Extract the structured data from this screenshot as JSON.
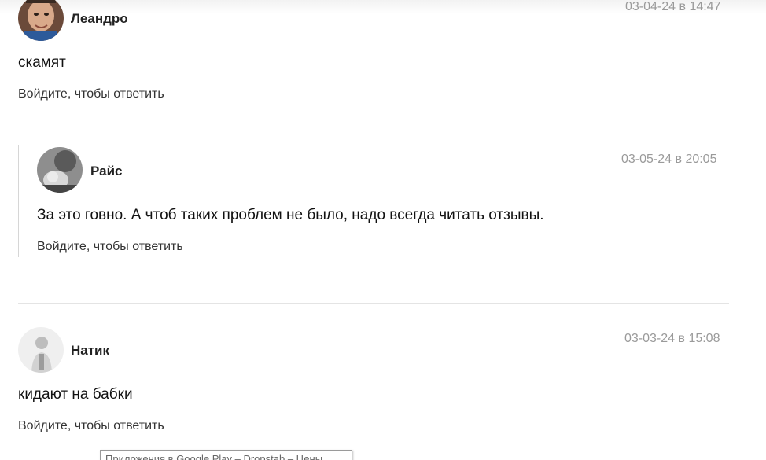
{
  "comments": [
    {
      "author": "Леандро",
      "date": "03-04-24 в 14:47",
      "text": "скамят",
      "reply_label": "Войдите, чтобы ответить"
    },
    {
      "author": "Райс",
      "date": "03-05-24 в 20:05",
      "text": "За это говно. А чтоб таких проблем не было, надо всегда читать отзывы.",
      "reply_label": "Войдите, чтобы ответить"
    },
    {
      "author": "Натик",
      "date": "03-03-24 в 15:08",
      "text": "кидают на бабки",
      "reply_label": "Войдите, чтобы ответить"
    }
  ],
  "tooltip": {
    "text": "Приложения в Google Play – Dropstab – Цены"
  },
  "colors": {
    "date": "#9a9a9a",
    "text": "#111111",
    "divider": "#e4e4e4",
    "rail": "#d6d6d6"
  }
}
